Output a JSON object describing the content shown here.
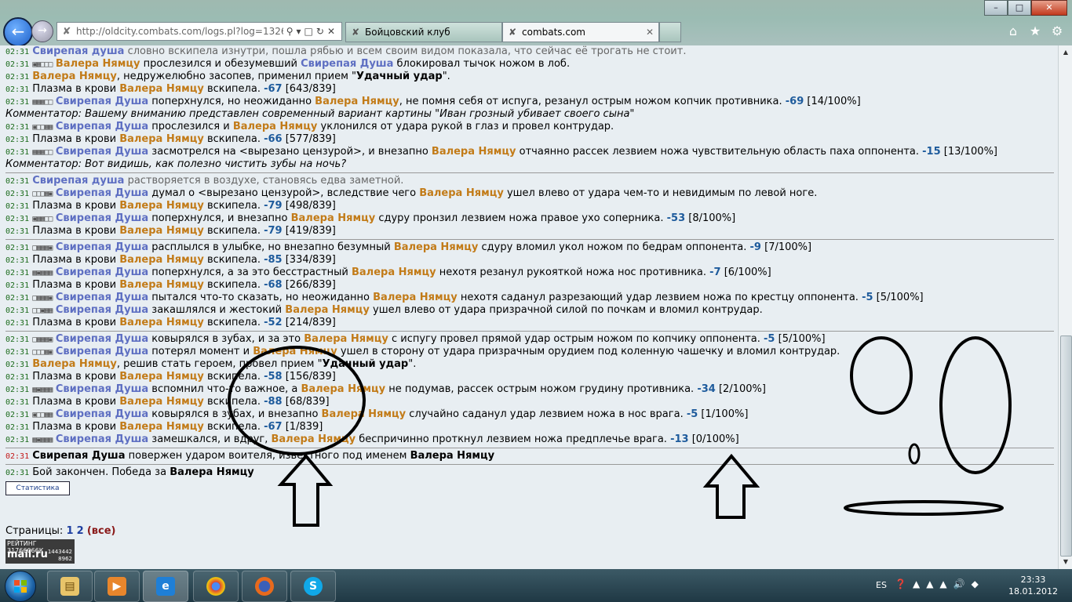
{
  "browser": {
    "url": "http://oldcity.combats.com/logs.pl?log=132692",
    "tabs": [
      {
        "label": "Бойцовский клуб"
      },
      {
        "label": "combats.com"
      }
    ]
  },
  "log": {
    "rows": [
      {
        "time": "02:31",
        "dim": true,
        "parts": [
          {
            "c": "p1",
            "t": "Свирепая душа"
          },
          {
            "t": " словно вскипела изнутри, пошла рябью и всем своим видом показала, что сейчас её трогать не стоит."
          }
        ]
      },
      {
        "time": "02:31",
        "parts": [
          {
            "c": "sq",
            "t": "▣▦□□□"
          },
          {
            "c": "p2",
            "t": " Валера Нямцу"
          },
          {
            "t": " прослезился и обезумевший "
          },
          {
            "c": "p1",
            "t": "Свирепая Душа"
          },
          {
            "t": " блокировал тычок ножом в лоб."
          }
        ]
      },
      {
        "time": "02:31",
        "parts": [
          {
            "c": "p2",
            "t": "Валера Нямцу"
          },
          {
            "t": ", недружелюбно засопев, применил прием \""
          },
          {
            "c": "pb",
            "t": "Удачный удар"
          },
          {
            "t": "\"."
          }
        ]
      },
      {
        "time": "02:31",
        "parts": [
          {
            "t": "Плазма в крови "
          },
          {
            "c": "p2",
            "t": "Валера Нямцу"
          },
          {
            "t": " вскипела. "
          },
          {
            "c": "dmg",
            "t": "-67"
          },
          {
            "t": " [643/839]"
          }
        ]
      },
      {
        "time": "02:31",
        "parts": [
          {
            "c": "sq",
            "t": "▦▦▦□□"
          },
          {
            "c": "p1",
            "t": " Свирепая Душа"
          },
          {
            "t": " поперхнулся, но неожиданно "
          },
          {
            "c": "p2",
            "t": "Валера Нямцу"
          },
          {
            "t": ", не помня себя от испуга, резанул острым ножом копчик противника. "
          },
          {
            "c": "dmg",
            "t": "-69"
          },
          {
            "t": " [14/100%]"
          }
        ]
      },
      {
        "com": true,
        "parts": [
          {
            "t": "Комментатор: Вашему вниманию представлен современный вариант картины \"Иван грозный убивает своего сына\""
          }
        ]
      },
      {
        "time": "02:31",
        "parts": [
          {
            "c": "sq",
            "t": "▣□□▦▦"
          },
          {
            "c": "p1",
            "t": " Свирепая Душа"
          },
          {
            "t": " прослезился и "
          },
          {
            "c": "p2",
            "t": "Валера Нямцу"
          },
          {
            "t": " уклонился от удара рукой в глаз и провел контрудар."
          }
        ]
      },
      {
        "time": "02:31",
        "parts": [
          {
            "t": "Плазма в крови "
          },
          {
            "c": "p2",
            "t": "Валера Нямцу"
          },
          {
            "t": " вскипела. "
          },
          {
            "c": "dmg",
            "t": "-66"
          },
          {
            "t": " [577/839]"
          }
        ]
      },
      {
        "time": "02:31",
        "parts": [
          {
            "c": "sq",
            "t": "▦▦▦□□"
          },
          {
            "c": "p1",
            "t": " Свирепая Душа"
          },
          {
            "t": " засмотрелся на <вырезано цензурой>, и внезапно "
          },
          {
            "c": "p2",
            "t": "Валера Нямцу"
          },
          {
            "t": " отчаянно рассек лезвием ножа чувствительную область паха оппонента. "
          },
          {
            "c": "dmg",
            "t": "-15"
          },
          {
            "t": " [13/100%]"
          }
        ]
      },
      {
        "com": true,
        "sep": true,
        "parts": [
          {
            "t": "Комментатор: Вот видишь, как полезно чистить зубы на ночь?"
          }
        ]
      },
      {
        "time": "02:31",
        "dim": true,
        "parts": [
          {
            "c": "p1",
            "t": "Свирепая душа"
          },
          {
            "t": " растворяется в воздухе, становясь едва заметной."
          }
        ]
      },
      {
        "time": "02:31",
        "parts": [
          {
            "c": "sq",
            "t": "□□□▦▣"
          },
          {
            "c": "p1",
            "t": " Свирепая Душа"
          },
          {
            "t": " думал о <вырезано цензурой>, вследствие чего "
          },
          {
            "c": "p2",
            "t": "Валера Нямцу"
          },
          {
            "t": " ушел влево от удара чем-то и невидимым по левой ноге."
          }
        ]
      },
      {
        "time": "02:31",
        "parts": [
          {
            "t": "Плазма в крови "
          },
          {
            "c": "p2",
            "t": "Валера Нямцу"
          },
          {
            "t": " вскипела. "
          },
          {
            "c": "dmg",
            "t": "-79"
          },
          {
            "t": " [498/839]"
          }
        ]
      },
      {
        "time": "02:31",
        "parts": [
          {
            "c": "sq",
            "t": "▣▦▦□□"
          },
          {
            "c": "p1",
            "t": " Свирепая Душа"
          },
          {
            "t": " поперхнулся, и внезапно "
          },
          {
            "c": "p2",
            "t": "Валера Нямцу"
          },
          {
            "t": " сдуру пронзил лезвием ножа правое ухо соперника. "
          },
          {
            "c": "dmg",
            "t": "-53"
          },
          {
            "t": " [8/100%]"
          }
        ]
      },
      {
        "time": "02:31",
        "parts": [
          {
            "t": "Плазма в крови "
          },
          {
            "c": "p2",
            "t": "Валера Нямцу"
          },
          {
            "t": " вскипела. "
          },
          {
            "c": "dmg",
            "t": "-79"
          },
          {
            "t": " [419/839]"
          }
        ]
      },
      {
        "time": "02:31",
        "sep": true,
        "parts": [
          {
            "c": "sq",
            "t": "□▦▦▦▣"
          },
          {
            "c": "p1",
            "t": " Свирепая Душа"
          },
          {
            "t": " расплылся в улыбке, но внезапно безумный "
          },
          {
            "c": "p2",
            "t": "Валера Нямцу"
          },
          {
            "t": " сдуру вломил укол ножом по бедрам оппонента. "
          },
          {
            "c": "dmg",
            "t": "-9"
          },
          {
            "t": " [7/100%]"
          }
        ]
      },
      {
        "time": "02:31",
        "parts": [
          {
            "t": "Плазма в крови "
          },
          {
            "c": "p2",
            "t": "Валера Нямцу"
          },
          {
            "t": " вскипела. "
          },
          {
            "c": "dmg",
            "t": "-85"
          },
          {
            "t": " [334/839]"
          }
        ]
      },
      {
        "time": "02:31",
        "parts": [
          {
            "c": "sq",
            "t": "▦▣▦▦▦"
          },
          {
            "c": "p1",
            "t": " Свирепая Душа"
          },
          {
            "t": " поперхнулся, а за это бесстрастный "
          },
          {
            "c": "p2",
            "t": "Валера Нямцу"
          },
          {
            "t": " нехотя резанул рукояткой ножа нос противника. "
          },
          {
            "c": "dmg",
            "t": "-7"
          },
          {
            "t": " [6/100%]"
          }
        ]
      },
      {
        "time": "02:31",
        "parts": [
          {
            "t": "Плазма в крови "
          },
          {
            "c": "p2",
            "t": "Валера Нямцу"
          },
          {
            "t": " вскипела. "
          },
          {
            "c": "dmg",
            "t": "-68"
          },
          {
            "t": " [266/839]"
          }
        ]
      },
      {
        "time": "02:31",
        "parts": [
          {
            "c": "sq",
            "t": "□▦▦▦▣"
          },
          {
            "c": "p1",
            "t": " Свирепая Душа"
          },
          {
            "t": " пытался что-то сказать, но неожиданно "
          },
          {
            "c": "p2",
            "t": "Валера Нямцу"
          },
          {
            "t": " нехотя саданул разрезающий удар лезвием ножа по крестцу оппонента. "
          },
          {
            "c": "dmg",
            "t": "-5"
          },
          {
            "t": " [5/100%]"
          }
        ]
      },
      {
        "time": "02:31",
        "parts": [
          {
            "c": "sq",
            "t": "□□▣▦▦"
          },
          {
            "c": "p1",
            "t": " Свирепая Душа"
          },
          {
            "t": " закашлялся и жестокий "
          },
          {
            "c": "p2",
            "t": "Валера Нямцу"
          },
          {
            "t": " ушел влево от удара призрачной силой по почкам и вломил контрудар."
          }
        ]
      },
      {
        "time": "02:31",
        "parts": [
          {
            "t": "Плазма в крови "
          },
          {
            "c": "p2",
            "t": "Валера Нямцу"
          },
          {
            "t": " вскипела. "
          },
          {
            "c": "dmg",
            "t": "-52"
          },
          {
            "t": " [214/839]"
          }
        ]
      },
      {
        "time": "02:31",
        "sep": true,
        "parts": [
          {
            "c": "sq",
            "t": "□▦▦▦▣"
          },
          {
            "c": "p1",
            "t": " Свирепая Душа"
          },
          {
            "t": " ковырялся в зубах, и за это "
          },
          {
            "c": "p2",
            "t": "Валера Нямцу"
          },
          {
            "t": " с испугу провел прямой удар острым ножом по копчику оппонента. "
          },
          {
            "c": "dmg",
            "t": "-5"
          },
          {
            "t": " [5/100%]"
          }
        ]
      },
      {
        "time": "02:31",
        "parts": [
          {
            "c": "sq",
            "t": "□□□▦▣"
          },
          {
            "c": "p1",
            "t": " Свирепая Душа"
          },
          {
            "t": " потерял момент и "
          },
          {
            "c": "p2",
            "t": "Валера Нямцу"
          },
          {
            "t": " ушел в сторону от удара призрачным орудием под коленную чашечку и вломил контрудар."
          }
        ]
      },
      {
        "time": "02:31",
        "parts": [
          {
            "c": "p2",
            "t": "Валера Нямцу"
          },
          {
            "t": ", решив стать героем, провел прием \""
          },
          {
            "c": "pb",
            "t": "Удачный удар"
          },
          {
            "t": "\"."
          }
        ]
      },
      {
        "time": "02:31",
        "parts": [
          {
            "t": "Плазма в крови "
          },
          {
            "c": "p2",
            "t": "Валера Нямцу"
          },
          {
            "t": " вскипела. "
          },
          {
            "c": "dmg",
            "t": "-58"
          },
          {
            "t": " [156/839]"
          }
        ]
      },
      {
        "time": "02:31",
        "parts": [
          {
            "c": "sq",
            "t": "▦▣▦▦▦"
          },
          {
            "c": "p1",
            "t": " Свирепая Душа"
          },
          {
            "t": " вспомнил что-то важное, а "
          },
          {
            "c": "p2",
            "t": "Валера Нямцу"
          },
          {
            "t": " не подумав, рассек острым ножом грудину противника. "
          },
          {
            "c": "dmg",
            "t": "-34"
          },
          {
            "t": " [2/100%]"
          }
        ]
      },
      {
        "time": "02:31",
        "parts": [
          {
            "t": "Плазма в крови "
          },
          {
            "c": "p2",
            "t": "Валера Нямцу"
          },
          {
            "t": " вскипела. "
          },
          {
            "c": "dmg",
            "t": "-88"
          },
          {
            "t": " [68/839]"
          }
        ]
      },
      {
        "time": "02:31",
        "parts": [
          {
            "c": "sq",
            "t": "▣□□▦▦"
          },
          {
            "c": "p1",
            "t": " Свирепая Душа"
          },
          {
            "t": " ковырялся в зубах, и внезапно "
          },
          {
            "c": "p2",
            "t": "Валера Нямцу"
          },
          {
            "t": " случайно саданул удар лезвием ножа в нос врага. "
          },
          {
            "c": "dmg",
            "t": "-5"
          },
          {
            "t": " [1/100%]"
          }
        ]
      },
      {
        "time": "02:31",
        "parts": [
          {
            "t": "Плазма в крови "
          },
          {
            "c": "p2",
            "t": "Валера Нямцу"
          },
          {
            "t": " вскипела. "
          },
          {
            "c": "dmg",
            "t": "-67"
          },
          {
            "t": " [1/839]"
          }
        ]
      },
      {
        "time": "02:31",
        "parts": [
          {
            "c": "sq",
            "t": "▦▣▦▦▦"
          },
          {
            "c": "p1",
            "t": " Свирепая Душа"
          },
          {
            "t": " замешкался, и вдруг, "
          },
          {
            "c": "p2",
            "t": "Валера Нямцу"
          },
          {
            "t": " беспричинно проткнул лезвием ножа предплечье врага. "
          },
          {
            "c": "dmg",
            "t": "-13"
          },
          {
            "t": " [0/100%]"
          }
        ]
      },
      {
        "time": "02:31",
        "red": true,
        "sep": true,
        "parts": [
          {
            "c": "pb",
            "t": "Свирепая Душа"
          },
          {
            "t": " повержен ударом воителя, известного под именем "
          },
          {
            "c": "pb",
            "t": "Валера Нямцу"
          }
        ]
      },
      {
        "time": "02:31",
        "sep": true,
        "parts": [
          {
            "t": "Бой закончен. Победа за "
          },
          {
            "c": "pb",
            "t": "Валера Нямцу"
          }
        ]
      }
    ]
  },
  "controls": {
    "stats_label": "Статистика"
  },
  "pages": {
    "label": "Страницы: ",
    "p1": "1",
    "p2": "2",
    "all": "все"
  },
  "counter": {
    "rating": "РЕЙТИНГ 31766066К",
    "logo": "mail.ru",
    "n1": "1443442",
    "n2": "8962"
  },
  "taskbar": {
    "lang": "ES",
    "time": "23:33",
    "date": "18.01.2012"
  },
  "colors": {
    "player1": "#5e6fc2",
    "player2": "#c27b18",
    "damage": "#1e5b9c",
    "time": "#1b6b1b"
  }
}
